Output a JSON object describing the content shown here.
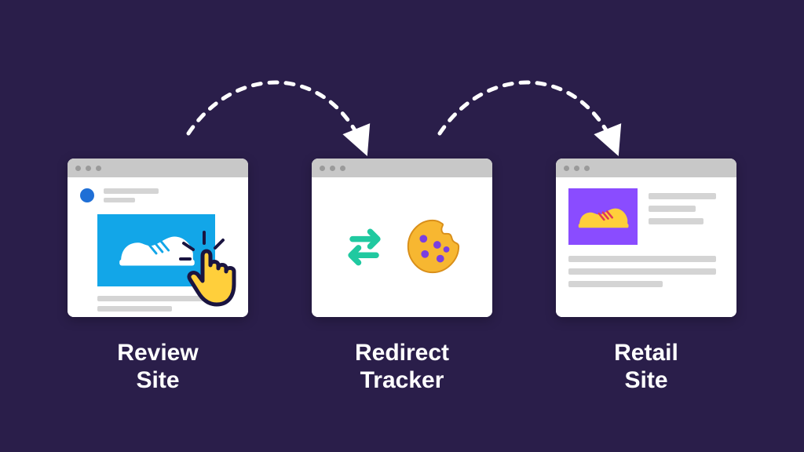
{
  "panels": {
    "review": {
      "label_line1": "Review",
      "label_line2": "Site"
    },
    "tracker": {
      "label_line1": "Redirect",
      "label_line2": "Tracker"
    },
    "retail": {
      "label_line1": "Retail",
      "label_line2": "Site"
    }
  },
  "icons": {
    "review_hero": "sneaker-white",
    "review_pointer": "click-hand",
    "tracker_swap": "swap-arrows",
    "tracker_cookie": "cookie",
    "retail_thumb": "sneaker-yellow"
  },
  "colors": {
    "bg": "#2a1e4a",
    "hero_blue": "#12a6e8",
    "swap_green": "#20c9a0",
    "cookie": "#f7b731",
    "cookie_chip": "#7a3fe0",
    "retail_accent": "#8a4cff",
    "pointer_fill": "#ffcf3b",
    "pointer_stroke": "#1a1440"
  }
}
